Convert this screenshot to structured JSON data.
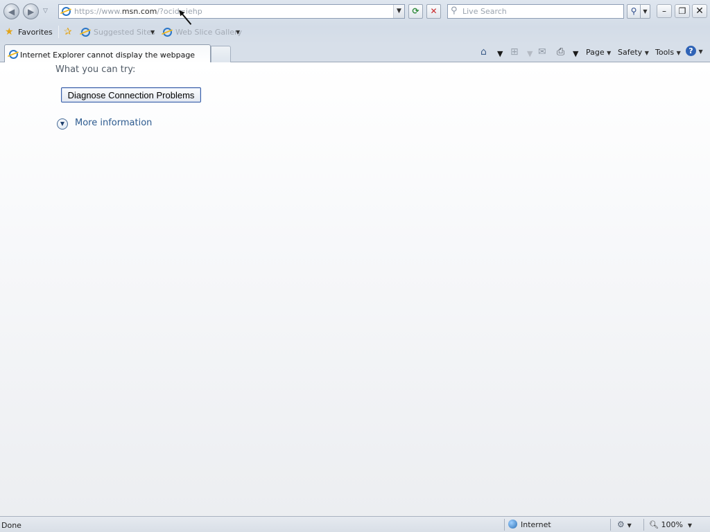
{
  "browser": {
    "address": {
      "url_prefix": "https://www.",
      "url_domain": "msn.com",
      "url_suffix": "/?ocid=iehp"
    },
    "search_placeholder": "Live Search",
    "favorites_bar": {
      "favorites_label": "Favorites",
      "suggested_sites_label": "Suggested Sites",
      "web_slice_gallery_label": "Web Slice Gallery"
    },
    "tab": {
      "title": "Internet Explorer cannot display the webpage"
    },
    "command_bar": {
      "page_label": "Page",
      "safety_label": "Safety",
      "tools_label": "Tools"
    }
  },
  "content": {
    "what_you_can_try": "What you can try:",
    "diagnose_button": "Diagnose Connection Problems",
    "more_information": "More information"
  },
  "statusbar": {
    "status_text": "Done",
    "zone_label": "Internet",
    "zoom_label": "100%"
  },
  "icons": [
    "back-icon",
    "forward-icon",
    "refresh-icon",
    "stop-icon",
    "search-icon",
    "home-icon",
    "rss-icon",
    "mail-icon",
    "print-icon",
    "help-icon",
    "globe-icon",
    "zoom-icon"
  ]
}
